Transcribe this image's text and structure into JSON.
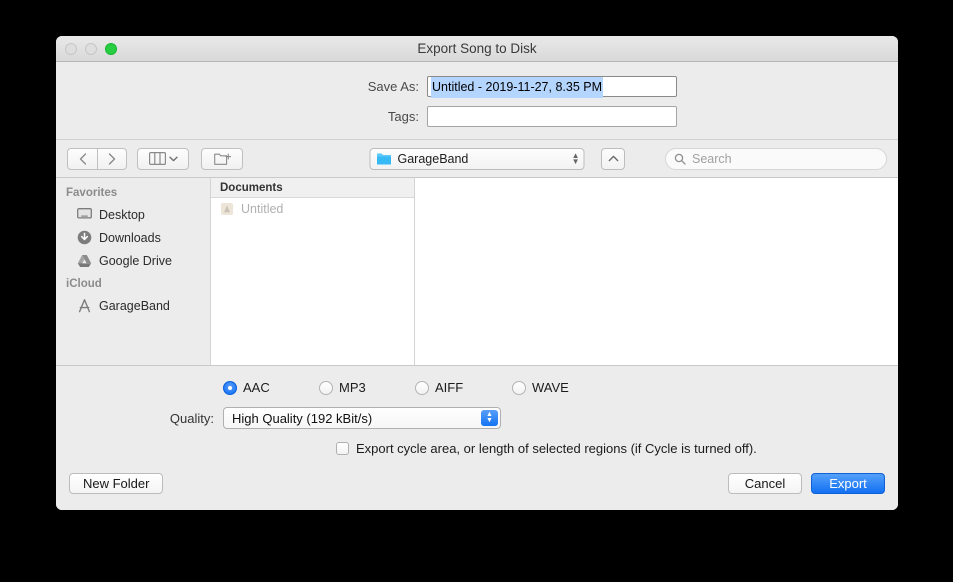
{
  "window": {
    "title": "Export Song to Disk",
    "traffic_lights": [
      {
        "name": "close-button",
        "state": "disabled"
      },
      {
        "name": "minimize-button",
        "state": "disabled"
      },
      {
        "name": "zoom-button",
        "state": "enabled",
        "color": "#28cd41"
      }
    ]
  },
  "fields": {
    "save_as_label": "Save As:",
    "save_as_value": "Untitled - 2019-11-27, 8.35 PM",
    "tags_label": "Tags:",
    "tags_value": "",
    "selection_color": "#b4d5fe"
  },
  "toolbar": {
    "back_icon": "chevron-left-icon",
    "forward_icon": "chevron-right-icon",
    "view_icon": "column-view-icon",
    "new_folder_icon": "new-folder-icon",
    "path_label": "GarageBand",
    "path_icon": "blue-folder-icon",
    "collapse_icon": "chevron-up-icon",
    "search_icon": "search-icon",
    "search_placeholder": "Search",
    "search_value": ""
  },
  "sidebar": {
    "sections": [
      {
        "header": "Favorites",
        "items": [
          {
            "label": "Desktop",
            "icon": "desktop-icon"
          },
          {
            "label": "Downloads",
            "icon": "downloads-icon"
          },
          {
            "label": "Google Drive",
            "icon": "google-drive-icon"
          }
        ]
      },
      {
        "header": "iCloud",
        "items": [
          {
            "label": "GarageBand",
            "icon": "garageband-app-icon"
          }
        ]
      }
    ]
  },
  "browser": {
    "column_header": "Documents",
    "files": [
      {
        "name": "Untitled",
        "icon": "garageband-document-icon",
        "dimmed": true
      }
    ]
  },
  "options": {
    "formats": [
      {
        "label": "AAC",
        "selected": true
      },
      {
        "label": "MP3",
        "selected": false
      },
      {
        "label": "AIFF",
        "selected": false
      },
      {
        "label": "WAVE",
        "selected": false
      }
    ],
    "quality_label": "Quality:",
    "quality_value": "High Quality (192 kBit/s)",
    "cycle_checkbox_label": "Export cycle area, or length of selected regions (if Cycle is turned off).",
    "cycle_checked": false
  },
  "footer": {
    "new_folder_label": "New Folder",
    "cancel_label": "Cancel",
    "export_label": "Export",
    "accent_color": "#1270f2"
  }
}
